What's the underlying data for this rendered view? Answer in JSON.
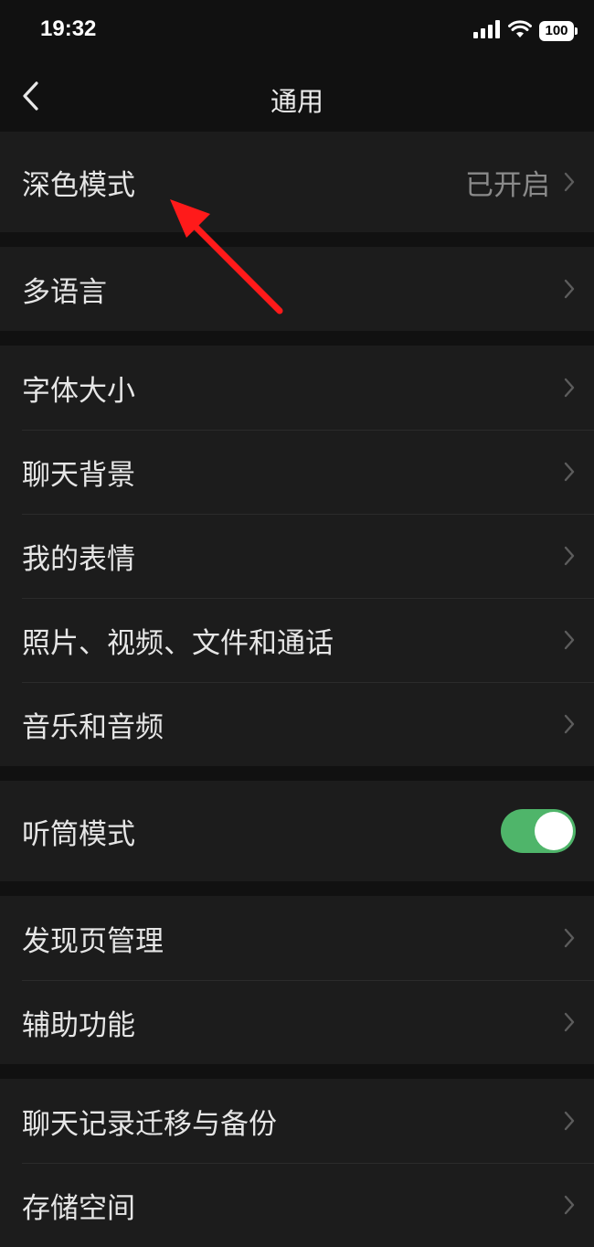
{
  "status_bar": {
    "time": "19:32",
    "battery": "100",
    "icons": [
      "signal-bars-icon",
      "wifi-icon",
      "battery-icon"
    ]
  },
  "nav": {
    "title": "通用",
    "back_icon": "chevron-left-icon"
  },
  "groups": [
    {
      "items": [
        {
          "label": "深色模式",
          "value": "已开启"
        }
      ]
    },
    {
      "items": [
        {
          "label": "多语言"
        }
      ]
    },
    {
      "items": [
        {
          "label": "字体大小"
        },
        {
          "label": "聊天背景"
        },
        {
          "label": "我的表情"
        },
        {
          "label": "照片、视频、文件和通话"
        },
        {
          "label": "音乐和音频"
        }
      ]
    },
    {
      "items": [
        {
          "label": "听筒模式",
          "toggle": "on"
        }
      ]
    },
    {
      "items": [
        {
          "label": "发现页管理"
        },
        {
          "label": "辅助功能"
        }
      ]
    },
    {
      "items": [
        {
          "label": "聊天记录迁移与备份"
        },
        {
          "label": "存储空间"
        }
      ]
    }
  ],
  "colors": {
    "background": "#111111",
    "row_background": "#1c1c1c",
    "toggle_on": "#4fb56a",
    "annotation_arrow": "#ff1a1a"
  }
}
